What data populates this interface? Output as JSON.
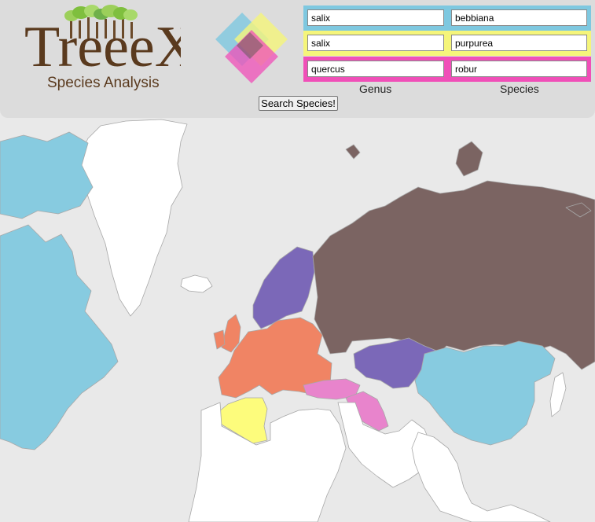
{
  "app": {
    "logo_title": "TreeeX",
    "logo_subtitle": "Species Analysis"
  },
  "search_rows": [
    {
      "genus": "salix",
      "species": "bebbiana",
      "color": "#7ec8e0"
    },
    {
      "genus": "salix",
      "species": "purpurea",
      "color": "#f5f57a"
    },
    {
      "genus": "quercus",
      "species": "robur",
      "color": "#f04fb8"
    }
  ],
  "labels": {
    "genus": "Genus",
    "species": "Species",
    "search_button": "Search Species!"
  },
  "map_colors": {
    "ocean": "#e9e9e9",
    "land": "#ffffff",
    "border": "#a8a8a8",
    "blue": "#87cbe0",
    "purple": "#7b68b8",
    "orange": "#f08464",
    "brown": "#7b6462",
    "pink": "#e884cc",
    "yellow": "#fdfc7c"
  }
}
